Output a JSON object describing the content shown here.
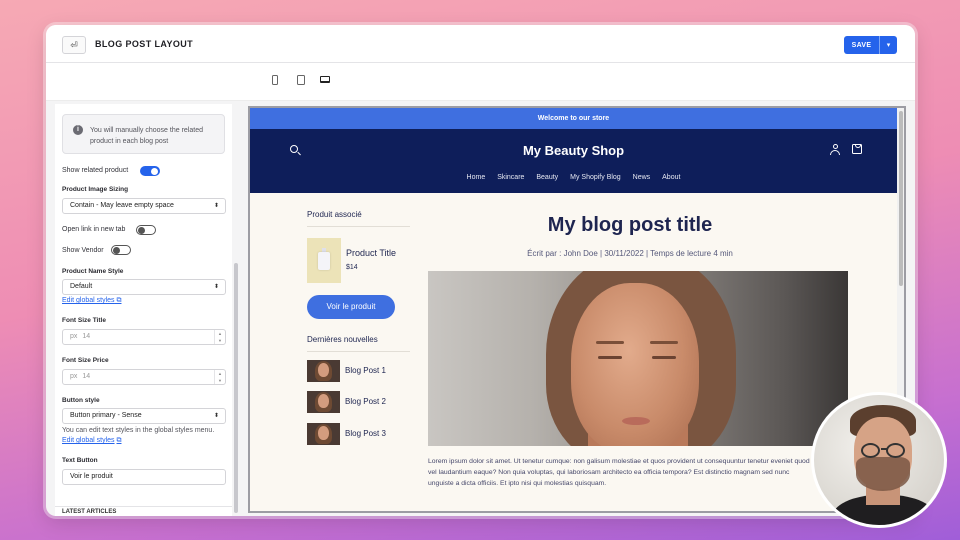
{
  "topbar": {
    "title": "BLOG POST LAYOUT",
    "back_icon": "⏎",
    "save_label": "SAVE",
    "save_dropdown_icon": "▾"
  },
  "devices": [
    "mobile",
    "tablet",
    "desktop"
  ],
  "panel": {
    "notice": "You will manually choose the related product in each blog post",
    "info_icon": "i",
    "show_related_label": "Show related product",
    "show_related_on": true,
    "image_sizing_label": "Product Image Sizing",
    "image_sizing_value": "Contain - May leave empty space",
    "open_new_tab_label": "Open link in new tab",
    "show_vendor_label": "Show Vendor",
    "name_style_label": "Product Name Style",
    "name_style_value": "Default",
    "edit_global_styles": "Edit global styles",
    "font_size_title_label": "Font Size Title",
    "font_size_title_unit": "px",
    "font_size_title_value": "14",
    "font_size_price_label": "Font Size Price",
    "font_size_price_unit": "px",
    "font_size_price_value": "14",
    "button_style_label": "Button style",
    "button_style_value": "Button primary - Sense",
    "button_help": "You can edit text styles in the global styles menu.",
    "edit_global_styles_2": "Edit global styles",
    "text_button_label": "Text Button",
    "text_button_value": "Voir le produit",
    "footer_label": "LATEST ARTICLES",
    "select_arrow": "⬍",
    "spin_up": "▲",
    "spin_down": "▼",
    "external_icon": "⧉"
  },
  "preview": {
    "announcement": "Welcome to our store",
    "shop_name": "My Beauty Shop",
    "nav": [
      "Home",
      "Skincare",
      "Beauty",
      "My Shopify Blog",
      "News",
      "About"
    ],
    "related_heading": "Produit associé",
    "product_title": "Product Title",
    "product_price": "$14",
    "buy_button": "Voir le produit",
    "latest_heading": "Dernières nouvelles",
    "posts": [
      "Blog Post 1",
      "Blog Post 2",
      "Blog Post 3"
    ],
    "blog_title": "My blog post title",
    "meta": "Écrit par : John Doe  |  30/11/2022  |  Temps de lecture 4 min",
    "body": "Lorem ipsum dolor sit amet. Ut tenetur cumque: non galisum molestiae et quos provident ut consequuntur tenetur eveniet quod vel laudantium eaque? Non quia voluptas, qui laboriosam architecto ea officia tempora? Est distinctio magnam sed nunc unguiste a dicta officiis. Et ipto nisi qui molestias quisquam."
  },
  "colors": {
    "accent": "#2563eb",
    "announcement_bg": "#3f6fe0",
    "header_bg": "#0e1e5a",
    "preview_bg": "#fbf8f2"
  }
}
